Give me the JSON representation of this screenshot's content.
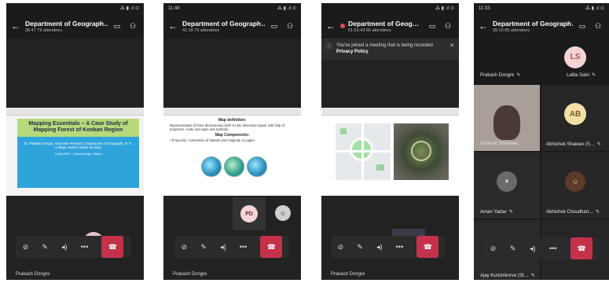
{
  "phones": [
    {
      "status_time": "",
      "status_icons": "⁂ ▮ .ıl ⊙",
      "title": "Department of Geograph…",
      "subtitle": "36:47   79 attendees",
      "slide": {
        "title": "Mapping Essentials – A Case Study of Mapping Forest of Konkan Region",
        "author": "Dr. Prakash Dongre, Associate Professor, Department of Geography, R. K. College, Mahul (West), Mumbai",
        "date": "14/06/2021 · Dept/College, Mahul"
      },
      "bottom_name": "Prakash Dongre"
    },
    {
      "status_time": "11:48",
      "status_icons": "⁂ ▮ .ıl ⊙",
      "title": "Department of Geograph…",
      "subtitle": "41:18   79 attendees",
      "slide": {
        "title": "Map definition:",
        "body": "Representation of three dimensional earth on two dimension paper with help of projection, scale and signs and symbols.",
        "sub": "Map Components:",
        "bullet": "• Projection: Conversion of latitude and longitude on paper"
      },
      "pip_initials": "PD",
      "bottom_name": "Prakash Dongre"
    },
    {
      "status_time": "",
      "status_icons": "⁂ ▮ .ıl ⊙",
      "title": "Department of Geog…",
      "subtitle": "01:51:43   66 attendees",
      "banner": "You've joined a meeting that is being recorded.",
      "banner_link": "Privacy Policy",
      "bottom_name": "Prakash Dongre"
    },
    {
      "status_time": "11:33",
      "status_icons": "⁂ ▮ .ıl ⊙",
      "title": "Department of Geograph…",
      "subtitle": "28:10   85 attendees",
      "tiles": [
        {
          "name": "Prakash Dongre",
          "initials": ""
        },
        {
          "name": "Lalita Salvi",
          "initials": "LS"
        },
        {
          "name": "Vrushali Shelenao",
          "initials": ""
        },
        {
          "name": "Abhishek Shawan (S…",
          "initials": "AB"
        },
        {
          "name": "Aman Yadav",
          "initials": ""
        },
        {
          "name": "Abhishek Choudhari…",
          "initials": ""
        },
        {
          "name": "Ajay Kunchikorve (St…",
          "initials": ""
        },
        {
          "name": "",
          "initials": ""
        }
      ]
    }
  ],
  "colors": {
    "hangup": "#c4314b",
    "bg": "#1b1b1b",
    "slide_bg1": "#27a7e0",
    "slide_green": "#a9d46f"
  }
}
